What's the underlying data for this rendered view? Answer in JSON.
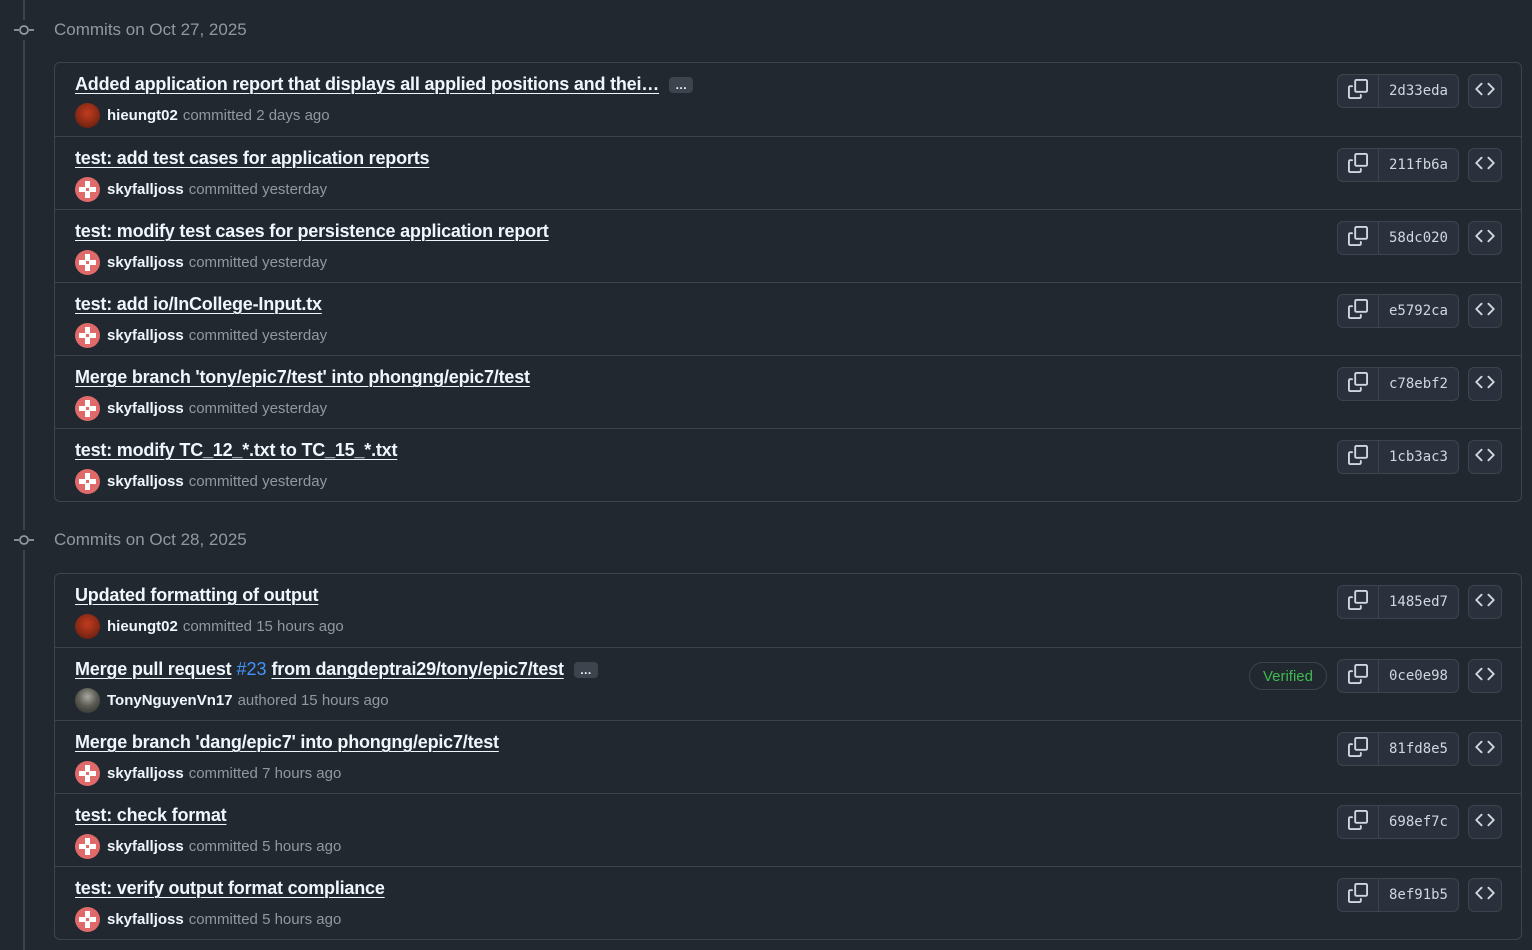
{
  "groups": [
    {
      "title": "Commits on Oct 27, 2025",
      "commits": [
        {
          "message": "Added application report that displays all applied positions and thei…",
          "has_ellipsis": true,
          "author": "hieungt02",
          "avatar": "hieu",
          "action": "committed",
          "time": "2 days ago",
          "sha": "2d33eda"
        },
        {
          "message": "test: add test cases for application reports",
          "author": "skyfalljoss",
          "avatar": "sky",
          "action": "committed",
          "time": "yesterday",
          "sha": "211fb6a"
        },
        {
          "message": "test: modify test cases for persistence application report",
          "author": "skyfalljoss",
          "avatar": "sky",
          "action": "committed",
          "time": "yesterday",
          "sha": "58dc020"
        },
        {
          "message": "test: add io/InCollege-Input.tx",
          "author": "skyfalljoss",
          "avatar": "sky",
          "action": "committed",
          "time": "yesterday",
          "sha": "e5792ca"
        },
        {
          "message": "Merge branch 'tony/epic7/test' into phongng/epic7/test",
          "author": "skyfalljoss",
          "avatar": "sky",
          "action": "committed",
          "time": "yesterday",
          "sha": "c78ebf2"
        },
        {
          "message": "test: modify TC_12_*.txt to TC_15_*.txt",
          "author": "skyfalljoss",
          "avatar": "sky",
          "action": "committed",
          "time": "yesterday",
          "sha": "1cb3ac3"
        }
      ]
    },
    {
      "title": "Commits on Oct 28, 2025",
      "commits": [
        {
          "message": "Updated formatting of output",
          "author": "hieungt02",
          "avatar": "hieu",
          "action": "committed",
          "time": "15 hours ago",
          "sha": "1485ed7"
        },
        {
          "message_prefix": "Merge pull request",
          "pr": "#23",
          "message_suffix": "from dangdeptrai29/tony/epic7/test",
          "has_ellipsis": true,
          "author": "TonyNguyenVn17",
          "avatar": "tony",
          "action": "authored",
          "time": "15 hours ago",
          "sha": "0ce0e98",
          "verified": "Verified"
        },
        {
          "message": "Merge branch 'dang/epic7' into phongng/epic7/test",
          "author": "skyfalljoss",
          "avatar": "sky",
          "action": "committed",
          "time": "7 hours ago",
          "sha": "81fd8e5"
        },
        {
          "message": "test: check format",
          "author": "skyfalljoss",
          "avatar": "sky",
          "action": "committed",
          "time": "5 hours ago",
          "sha": "698ef7c"
        },
        {
          "message": "test: verify output format compliance",
          "author": "skyfalljoss",
          "avatar": "sky",
          "action": "committed",
          "time": "5 hours ago",
          "sha": "8ef91b5"
        }
      ]
    }
  ],
  "ellipsis_label": "…",
  "colors": {
    "background": "#212830",
    "border": "#3d444d",
    "text": "#f0f6fc",
    "muted": "#9198a1",
    "verified": "#3fb950",
    "link": "#4493f8"
  }
}
